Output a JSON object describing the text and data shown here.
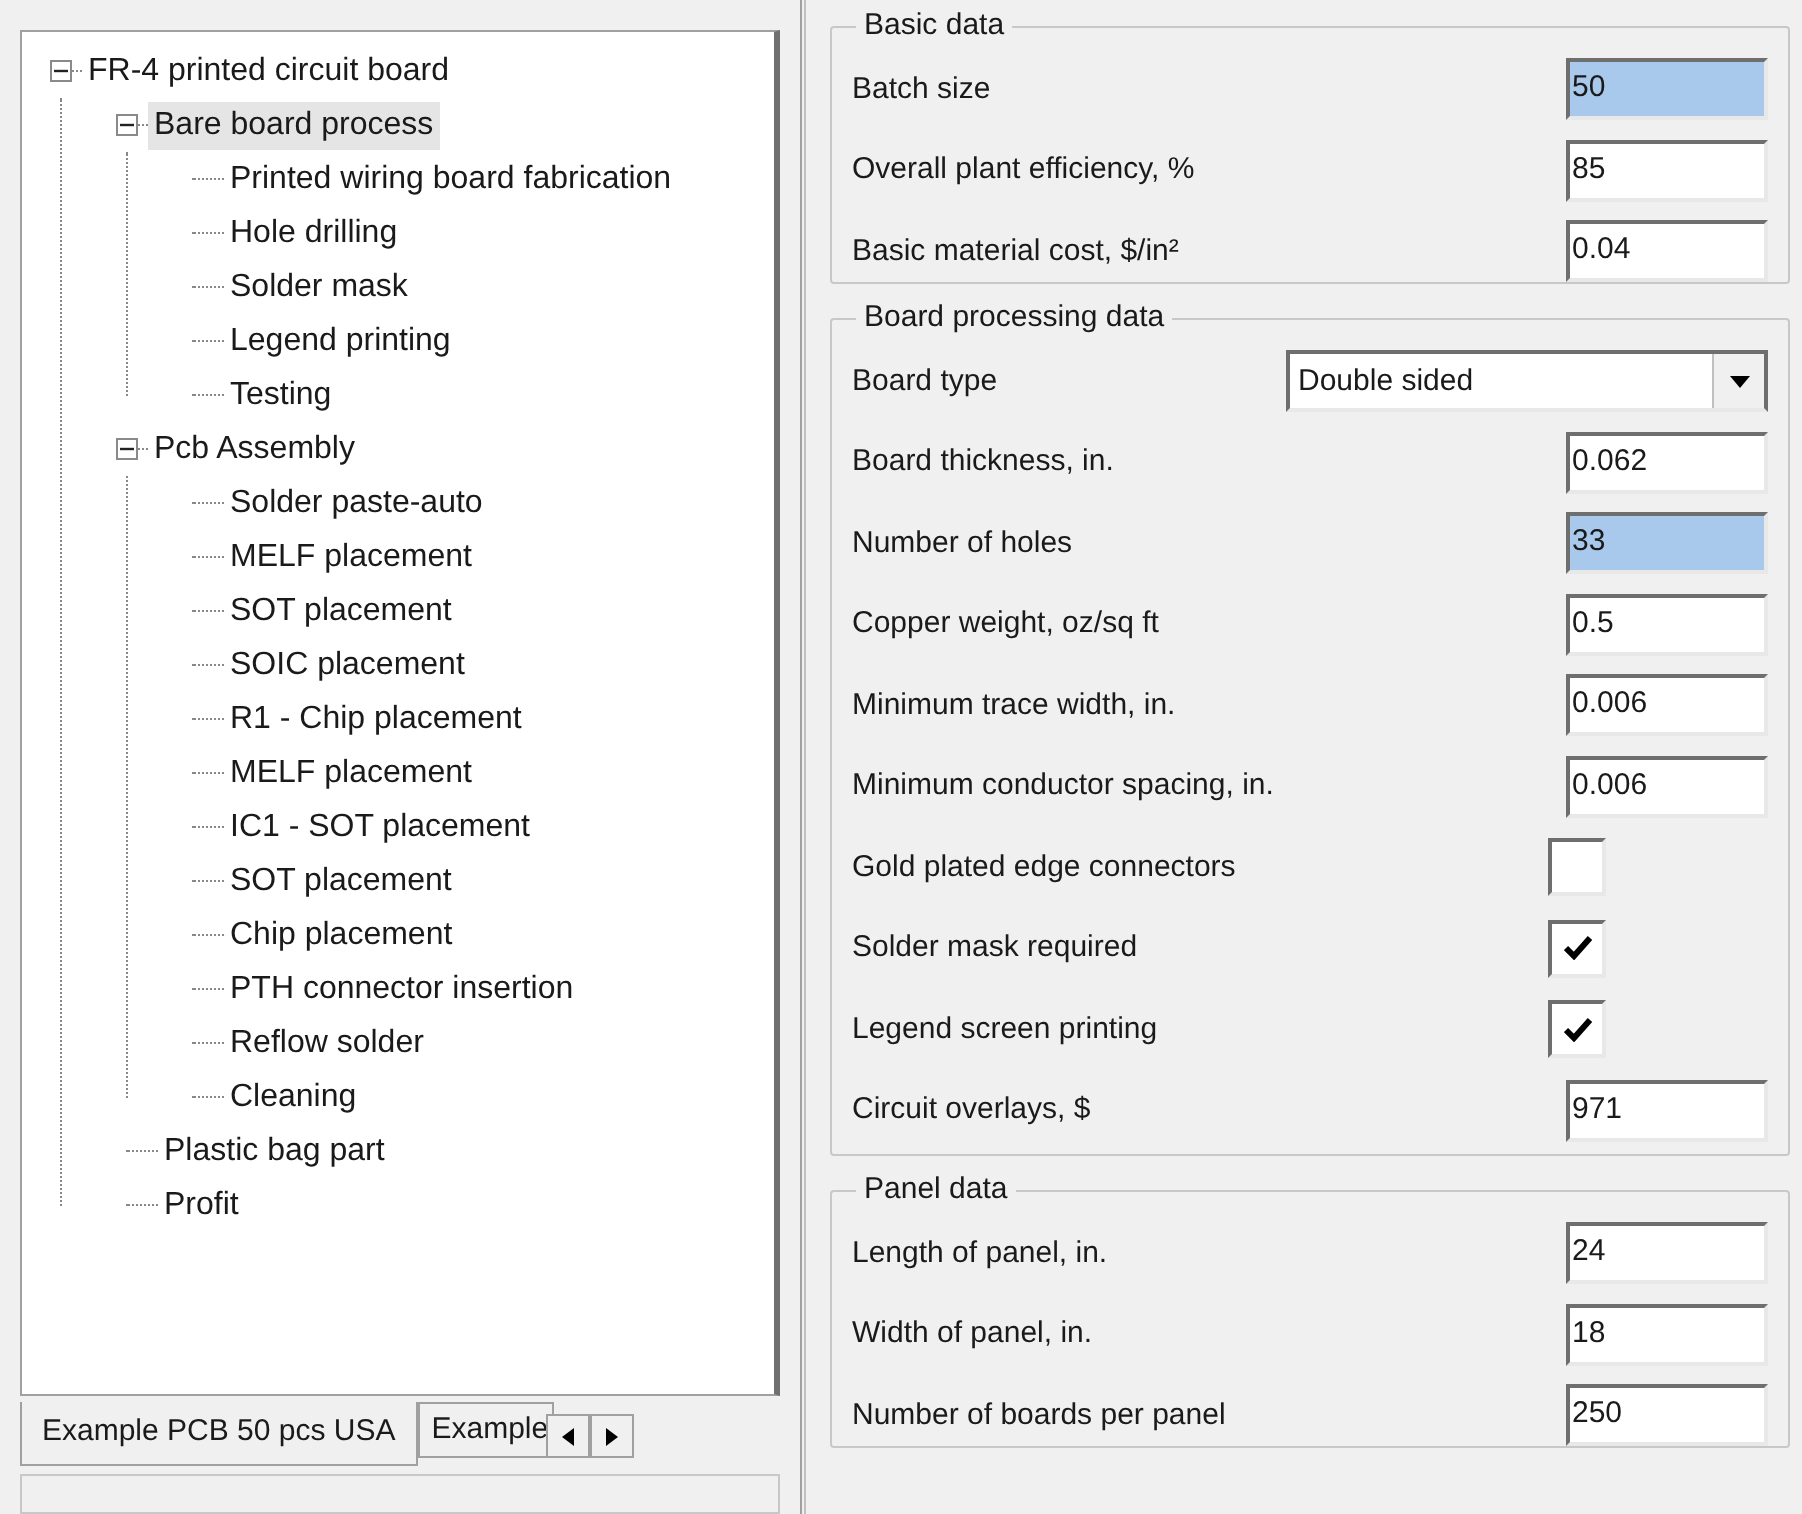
{
  "tree": {
    "label": "FR-4 printed circuit board",
    "expanded": true,
    "selected": false,
    "children": [
      {
        "label": "Bare board process",
        "expanded": true,
        "selected": true,
        "children": [
          {
            "label": "Printed wiring board fabrication",
            "selected": false
          },
          {
            "label": "Hole drilling",
            "selected": false
          },
          {
            "label": "Solder mask",
            "selected": false
          },
          {
            "label": "Legend printing",
            "selected": false
          },
          {
            "label": "Testing",
            "selected": false
          }
        ]
      },
      {
        "label": "Pcb Assembly",
        "expanded": true,
        "selected": false,
        "children": [
          {
            "label": "Solder paste-auto",
            "selected": false
          },
          {
            "label": "MELF placement",
            "selected": false
          },
          {
            "label": "SOT placement",
            "selected": false
          },
          {
            "label": "SOIC placement",
            "selected": false
          },
          {
            "label": "R1 - Chip placement",
            "selected": false
          },
          {
            "label": "MELF placement",
            "selected": false
          },
          {
            "label": "IC1 - SOT placement",
            "selected": false
          },
          {
            "label": "SOT placement",
            "selected": false
          },
          {
            "label": "Chip placement",
            "selected": false
          },
          {
            "label": "PTH connector insertion",
            "selected": false
          },
          {
            "label": "Reflow solder",
            "selected": false
          },
          {
            "label": "Cleaning",
            "selected": false
          }
        ]
      },
      {
        "label": "Plastic bag part",
        "selected": false
      },
      {
        "label": "Profit",
        "selected": false
      }
    ]
  },
  "tabs": [
    {
      "label": "Example PCB 50 pcs USA",
      "selected": true
    },
    {
      "label": "Example",
      "selected": false
    }
  ],
  "groups": [
    {
      "title": "Basic data",
      "fields": [
        {
          "kind": "text",
          "label": "Batch size",
          "value": "50",
          "highlighted": true
        },
        {
          "kind": "text",
          "label": "Overall plant efficiency, %",
          "value": "85",
          "highlighted": false
        },
        {
          "kind": "text",
          "label": "Basic material cost, $/in²",
          "value": "0.04",
          "highlighted": false
        }
      ]
    },
    {
      "title": "Board processing data",
      "fields": [
        {
          "kind": "select",
          "label": "Board type",
          "value": "Double sided"
        },
        {
          "kind": "text",
          "label": "Board thickness, in.",
          "value": "0.062",
          "highlighted": false
        },
        {
          "kind": "text",
          "label": "Number of holes",
          "value": "33",
          "highlighted": true
        },
        {
          "kind": "text",
          "label": "Copper weight, oz/sq ft",
          "value": "0.5",
          "highlighted": false
        },
        {
          "kind": "text",
          "label": "Minimum trace width, in.",
          "value": "0.006",
          "highlighted": false
        },
        {
          "kind": "text",
          "label": "Minimum conductor spacing, in.",
          "value": "0.006",
          "highlighted": false
        },
        {
          "kind": "checkbox",
          "label": "Gold plated edge connectors",
          "checked": false
        },
        {
          "kind": "checkbox",
          "label": "Solder mask required",
          "checked": true
        },
        {
          "kind": "checkbox",
          "label": "Legend screen printing",
          "checked": true
        },
        {
          "kind": "text",
          "label": "Circuit overlays, $",
          "value": "971",
          "highlighted": false
        }
      ]
    },
    {
      "title": "Panel data",
      "fields": [
        {
          "kind": "text",
          "label": "Length of panel, in.",
          "value": "24",
          "highlighted": false
        },
        {
          "kind": "text",
          "label": "Width of panel, in.",
          "value": "18",
          "highlighted": false
        },
        {
          "kind": "text",
          "label": "Number of boards per panel",
          "value": "250",
          "highlighted": false
        }
      ]
    }
  ]
}
